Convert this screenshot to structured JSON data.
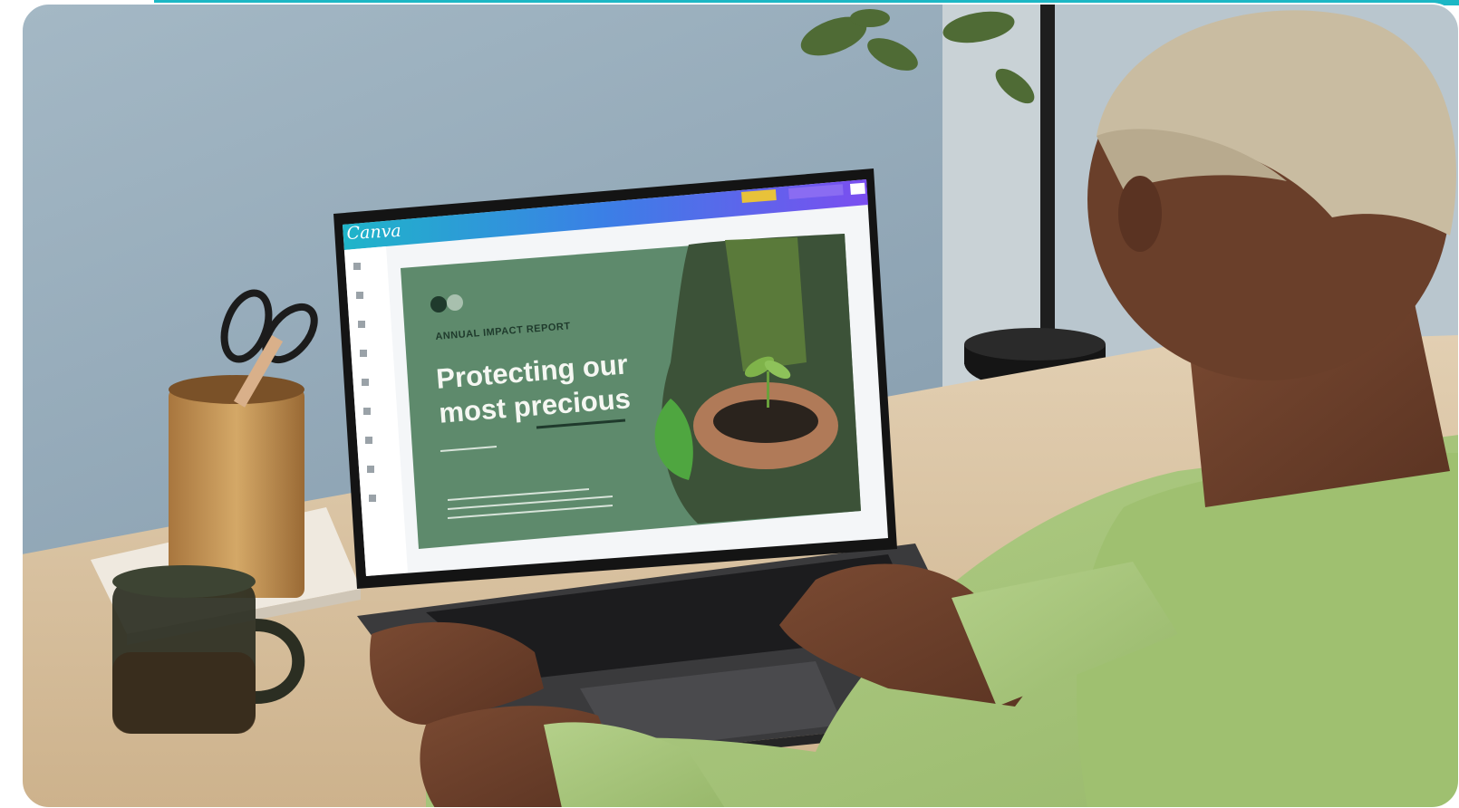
{
  "scene": {
    "description_for_alt": "Person typing on a laptop showing a Canva design editor",
    "colors": {
      "wall": "#8fa6b6",
      "desk": "#d8c3a3",
      "shirt": "#a9c77c",
      "screen_slide": "#5e8a6c",
      "canva_bar_start": "#1fb5c9",
      "canva_bar_end": "#7b4ef0"
    }
  },
  "laptop_screen": {
    "app_logo": "Canva",
    "slide": {
      "kicker": "ANNUAL IMPACT REPORT",
      "headline_line1": "Protecting our",
      "headline_line2": "most precious"
    },
    "toolbar_icons": [
      "design-icon",
      "elements-icon",
      "text-icon",
      "uploads-icon",
      "apps-icon",
      "more-icon"
    ]
  }
}
